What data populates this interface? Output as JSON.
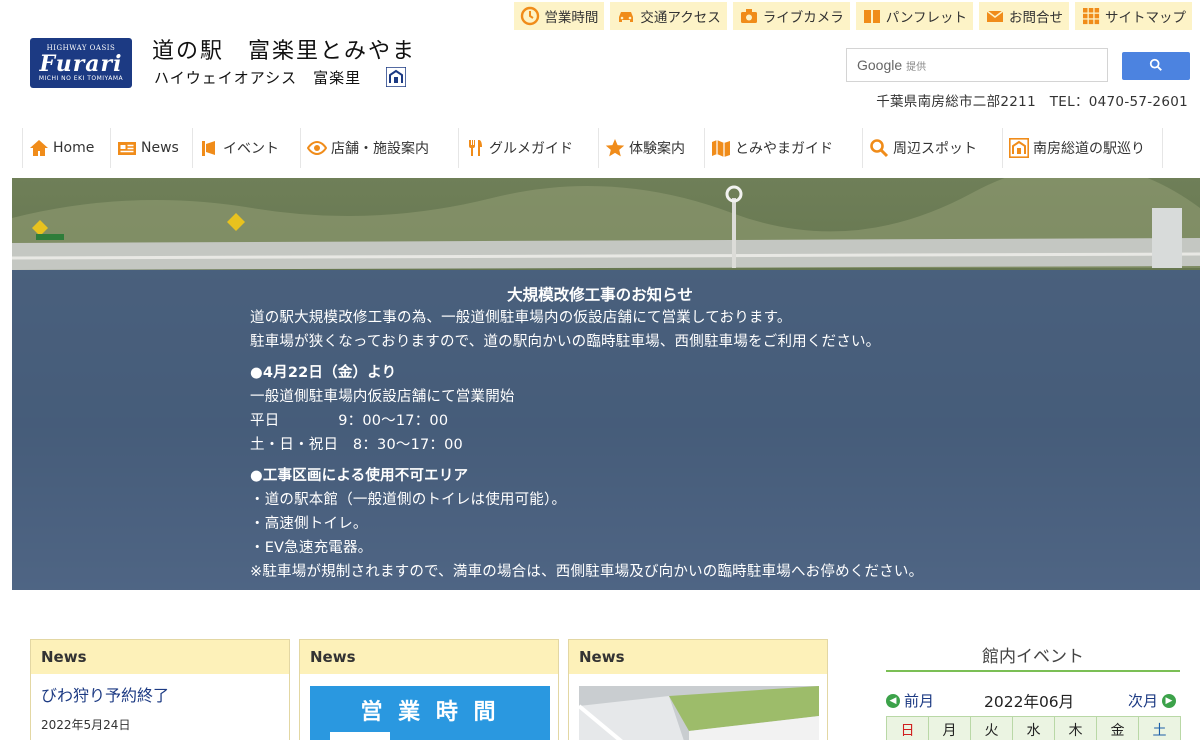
{
  "toplinks": [
    {
      "label": "営業時間",
      "icon": "clock-icon"
    },
    {
      "label": "交通アクセス",
      "icon": "car-icon"
    },
    {
      "label": "ライブカメラ",
      "icon": "camera-icon"
    },
    {
      "label": "パンフレット",
      "icon": "book-icon"
    },
    {
      "label": "お問合せ",
      "icon": "mail-icon"
    },
    {
      "label": "サイトマップ",
      "icon": "grid-icon"
    }
  ],
  "header": {
    "logo": {
      "line1": "HIGHWAY OASIS",
      "line2": "Furari",
      "line3": "MICHI NO EKI TOMIYAMA"
    },
    "title": "道の駅　富楽里とみやま",
    "subtitle": "ハイウェイオアシス　富楽里",
    "search": {
      "brand": "Google",
      "provided": "提供"
    },
    "address": "千葉県南房総市二部2211　TEL：0470-57-2601"
  },
  "nav": [
    {
      "label": "Home",
      "icon": "home-icon"
    },
    {
      "label": "News",
      "icon": "newspaper-icon"
    },
    {
      "label": "イベント",
      "icon": "megaphone-icon"
    },
    {
      "label": "店舗・施設案内",
      "icon": "eye-icon"
    },
    {
      "label": "グルメガイド",
      "icon": "fork-knife-icon"
    },
    {
      "label": "体験案内",
      "icon": "star-icon"
    },
    {
      "label": "とみやまガイド",
      "icon": "map-icon"
    },
    {
      "label": "周辺スポット",
      "icon": "search-icon"
    },
    {
      "label": "南房総道の駅巡り",
      "icon": "station-icon"
    }
  ],
  "notice": {
    "title": "大規模改修工事のお知らせ",
    "line1": "道の駅大規模改修工事の為、一般道側駐車場内の仮設店舗にて営業しております。",
    "line2": "駐車場が狭くなっておりますので、道の駅向かいの臨時駐車場、西側駐車場をご利用ください。",
    "sec1_head": "●4月22日（金）より",
    "sec1_l1": "一般道側駐車場内仮設店舗にて営業開始",
    "sec1_l2": "平日　　　　9：00〜17：00",
    "sec1_l3": "土・日・祝日　8：30〜17：00",
    "sec2_head": "●工事区画による使用不可エリア",
    "sec2_l1": "・道の駅本館（一般道側のトイレは使用可能）。",
    "sec2_l2": "・高速側トイレ。",
    "sec2_l3": "・EV急速充電器。",
    "sec2_l4": "※駐車場が規制されますので、満車の場合は、西側駐車場及び向かいの臨時駐車場へお停めください。"
  },
  "news_cards": [
    {
      "header": "News",
      "title": "びわ狩り予約終了",
      "date": "2022年5月24日"
    },
    {
      "header": "News",
      "image_text": "営 業 時 間"
    },
    {
      "header": "News"
    }
  ],
  "calendar": {
    "heading": "館内イベント",
    "prev": "前月",
    "month": "2022年06月",
    "next": "次月",
    "weekdays": [
      "日",
      "月",
      "火",
      "水",
      "木",
      "金",
      "土"
    ]
  },
  "colors": {
    "accent_orange": "#f08c1a",
    "brand_navy": "#1c3a83",
    "card_header": "#fdf1b9",
    "green": "#3ca24a"
  }
}
